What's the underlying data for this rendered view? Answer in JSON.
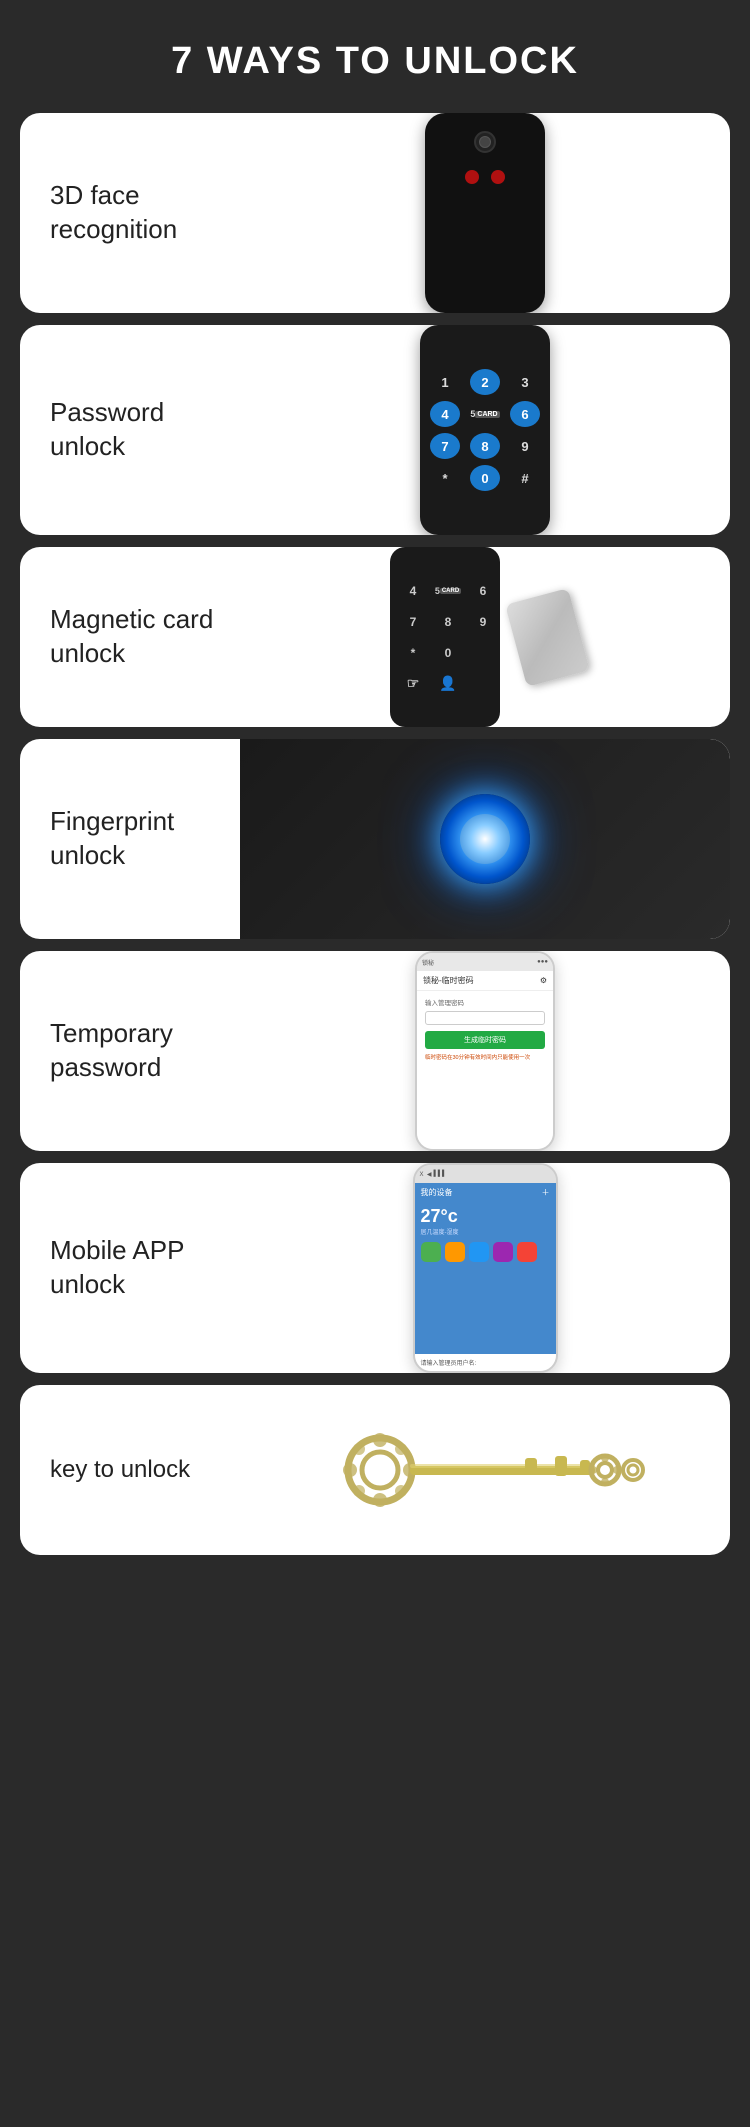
{
  "page": {
    "title": "7 WAYS TO UNLOCK",
    "bg_color": "#2a2a2a"
  },
  "cards": [
    {
      "id": "face-recognition",
      "label": "3D face\nrecognition"
    },
    {
      "id": "password-unlock",
      "label": "Password\nunlock"
    },
    {
      "id": "magnetic-card",
      "label": "Magnetic card\nunlock"
    },
    {
      "id": "fingerprint",
      "label": "Fingerprint\nunlock"
    },
    {
      "id": "temporary-password",
      "label": "Temporary\npassword"
    },
    {
      "id": "mobile-app",
      "label": "Mobile APP\nunlock"
    },
    {
      "id": "key-unlock",
      "label": "key to unlock"
    }
  ],
  "keypad": {
    "keys": [
      "1",
      "2",
      "3",
      "4",
      "5",
      "6",
      "7",
      "8",
      "9",
      "*",
      "0",
      "#"
    ],
    "highlighted": [
      "2",
      "4",
      "6",
      "7",
      "8",
      "0"
    ]
  },
  "app": {
    "title": "锁秘-临时密码",
    "input_label": "输入管理密码",
    "button_label": "生成临时密码",
    "note": "临时密码在30分钟有效时间内只能使用一次"
  },
  "app2": {
    "title": "我的设备",
    "temp": "27°c",
    "subtitle": "居几温度-湿度",
    "input_label": "请输入管理员用户名:"
  }
}
